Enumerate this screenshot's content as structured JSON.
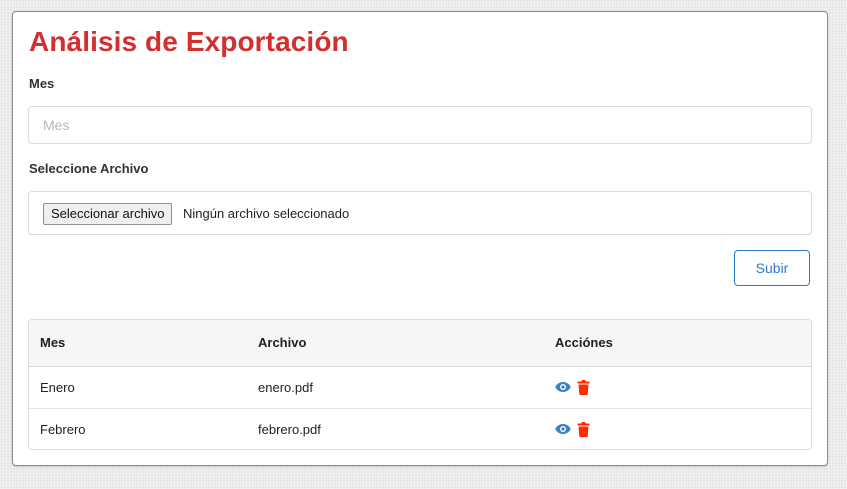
{
  "form": {
    "title": "Análisis de Exportación",
    "mes_label": "Mes",
    "mes_placeholder": "Mes",
    "mes_value": "",
    "archivo_label": "Seleccione Archivo",
    "file_button_label": "Seleccionar archivo",
    "file_status": "Ningún archivo seleccionado",
    "submit_label": "Subir"
  },
  "table": {
    "columns": [
      "Mes",
      "Archivo",
      "Acciónes"
    ],
    "rows": [
      {
        "mes": "Enero",
        "archivo": "enero.pdf"
      },
      {
        "mes": "Febrero",
        "archivo": "febrero.pdf"
      }
    ]
  },
  "icons": {
    "view": "eye-icon",
    "delete": "trash-icon"
  },
  "colors": {
    "title": "#d32f2f",
    "primary": "#2c7bc8",
    "view_icon": "#3a82c4",
    "delete_icon": "#ff2a00"
  }
}
